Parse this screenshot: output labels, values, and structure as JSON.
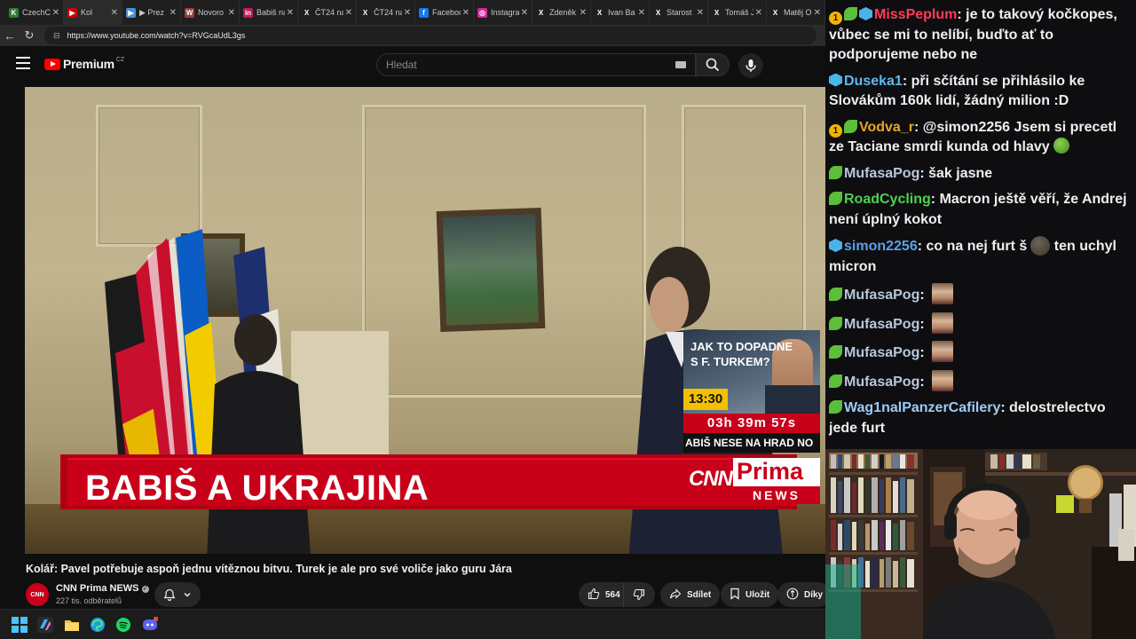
{
  "browser": {
    "tabs": [
      {
        "label": "CzechC",
        "color": "#2e7d32",
        "glyph": "K",
        "active": false
      },
      {
        "label": "Kol",
        "color": "#cc0000",
        "glyph": "▶",
        "active": true
      },
      {
        "label": "▶ Prez",
        "color": "#4a8fdc",
        "glyph": "▶",
        "active": false
      },
      {
        "label": "Novoro",
        "color": "#9c3b3b",
        "glyph": "W",
        "active": false
      },
      {
        "label": "Babiš na",
        "color": "#c2185b",
        "glyph": "in",
        "active": false
      },
      {
        "label": "ČT24 na",
        "color": "#1f1f1f",
        "glyph": "X",
        "active": false
      },
      {
        "label": "ČT24 na",
        "color": "#1f1f1f",
        "glyph": "X",
        "active": false
      },
      {
        "label": "Faceboo",
        "color": "#1877f2",
        "glyph": "f",
        "active": false
      },
      {
        "label": "Instagra",
        "color": "#d6249f",
        "glyph": "◎",
        "active": false
      },
      {
        "label": "Zdeněk",
        "color": "#1f1f1f",
        "glyph": "X",
        "active": false
      },
      {
        "label": "Ivan Ba",
        "color": "#1f1f1f",
        "glyph": "X",
        "active": false
      },
      {
        "label": "Starost",
        "color": "#1f1f1f",
        "glyph": "X",
        "active": false
      },
      {
        "label": "Tomáš J",
        "color": "#1f1f1f",
        "glyph": "X",
        "active": false
      },
      {
        "label": "Matěj O",
        "color": "#1f1f1f",
        "glyph": "X",
        "active": false
      }
    ],
    "url": "https://www.youtube.com/watch?v=RVGcaUdL3gs"
  },
  "youtube": {
    "logo_text": "Premium",
    "logo_superscript": "CZ",
    "search_placeholder": "Hledat",
    "video": {
      "headline": "BABIŠ A UKRAJINA",
      "promo_line1": "JAK TO DOPADNE",
      "promo_line2": "S F. TURKEM?",
      "time": "13:30",
      "countdown": "03h 39m 57s",
      "ticker": "ABIŠ NESE NA HRAD NO",
      "cnn": "CNN",
      "prima": "Prima",
      "news": "NEWS"
    },
    "title": "Kolář: Pavel potřebuje aspoň jednu vítěznou bitvu. Turek je ale pro své voliče jako guru Jára",
    "channel": {
      "name": "CNN Prima NEWS",
      "subscribers": "227 tis. odběratelů",
      "avatar_text": "CNN"
    },
    "actions": {
      "likes": "564",
      "share": "Sdílet",
      "save": "Uložit",
      "thanks": "Díky"
    }
  },
  "chat": {
    "messages": [
      {
        "user": "MissPeplum",
        "color": "#ff3b5c",
        "badges": [
          "coin",
          "leaf",
          "gem"
        ],
        "text": " je to takový kočkopes, vůbec se mi to nelíbí, buďto ať to podporujeme nebo ne"
      },
      {
        "user": "Duseka1",
        "color": "#5fb8f0",
        "badges": [
          "gem"
        ],
        "text": " při sčítání se přihlásilo ke Slovákům 160k lidí, žádný milion :D"
      },
      {
        "user": "Vodva_r",
        "color": "#e6a62a",
        "badges": [
          "coin",
          "leaf"
        ],
        "text": " @simon2256 Jsem si precetl ze Taciane smrdi kunda od hlavy"
      },
      {
        "user": "MufasaPog",
        "color": "#b7c7dd",
        "badges": [
          "leaf"
        ],
        "text": " šak jasne"
      },
      {
        "user": "RoadCycling",
        "color": "#4ed14e",
        "badges": [
          "leaf"
        ],
        "text": " Macron ještě věří, že Andrej není úplný kokot"
      },
      {
        "user": "simon2256",
        "color": "#5d9fe8",
        "badges": [
          "gem"
        ],
        "text": " co na nej furt š"
      },
      {
        "user": "MufasaPog",
        "color": "#b7c7dd",
        "badges": [
          "leaf"
        ],
        "text": ""
      },
      {
        "user": "MufasaPog",
        "color": "#b7c7dd",
        "badges": [
          "leaf"
        ],
        "text": ""
      },
      {
        "user": "MufasaPog",
        "color": "#b7c7dd",
        "badges": [
          "leaf"
        ],
        "text": ""
      },
      {
        "user": "MufasaPog",
        "color": "#b7c7dd",
        "badges": [
          "leaf"
        ],
        "text": ""
      },
      {
        "user": "Wag1nalPanzerCafilery",
        "color": "#9ecbf7",
        "badges": [
          "leaf"
        ],
        "text": " delostrelectvo jede furt"
      }
    ],
    "simon_suffix": " ten uchyl micron"
  }
}
